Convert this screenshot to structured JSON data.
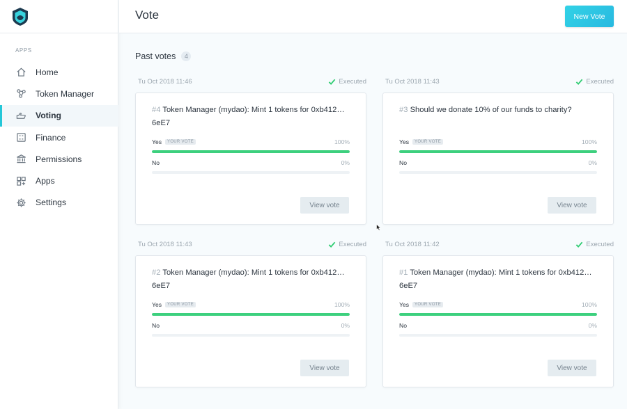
{
  "sidebar": {
    "apps_title": "APPS",
    "items": [
      {
        "label": "Home",
        "icon": "home-icon",
        "active": false
      },
      {
        "label": "Token Manager",
        "icon": "token-manager-icon",
        "active": false
      },
      {
        "label": "Voting",
        "icon": "voting-icon",
        "active": true
      },
      {
        "label": "Finance",
        "icon": "finance-icon",
        "active": false
      },
      {
        "label": "Permissions",
        "icon": "permissions-icon",
        "active": false
      },
      {
        "label": "Apps",
        "icon": "apps-icon",
        "active": false
      },
      {
        "label": "Settings",
        "icon": "settings-icon",
        "active": false
      }
    ]
  },
  "header": {
    "title": "Vote",
    "new_vote_label": "New Vote"
  },
  "main": {
    "section_title": "Past votes",
    "count": "4",
    "votes": [
      {
        "date": "Tu Oct 2018 11:46",
        "status": "Executed",
        "number": "#4",
        "question": "Token Manager (mydao): Mint 1 tokens for 0xb412… 6eE7",
        "yes_label": "Yes",
        "your_vote": "YOUR VOTE",
        "yes_pct": "100%",
        "yes_value": 100,
        "no_label": "No",
        "no_pct": "0%",
        "no_value": 0,
        "button": "View vote"
      },
      {
        "date": "Tu Oct 2018 11:43",
        "status": "Executed",
        "number": "#3",
        "question": "Should we donate 10% of our funds to charity?",
        "yes_label": "Yes",
        "your_vote": "YOUR VOTE",
        "yes_pct": "100%",
        "yes_value": 100,
        "no_label": "No",
        "no_pct": "0%",
        "no_value": 0,
        "button": "View vote"
      },
      {
        "date": "Tu Oct 2018 11:43",
        "status": "Executed",
        "number": "#2",
        "question": "Token Manager (mydao): Mint 1 tokens for 0xb412… 6eE7",
        "yes_label": "Yes",
        "your_vote": "YOUR VOTE",
        "yes_pct": "100%",
        "yes_value": 100,
        "no_label": "No",
        "no_pct": "0%",
        "no_value": 0,
        "button": "View vote"
      },
      {
        "date": "Tu Oct 2018 11:42",
        "status": "Executed",
        "number": "#1",
        "question": "Token Manager (mydao): Mint 1 tokens for 0xb412… 6eE7",
        "yes_label": "Yes",
        "your_vote": "YOUR VOTE",
        "yes_pct": "100%",
        "yes_value": 100,
        "no_label": "No",
        "no_pct": "0%",
        "no_value": 0,
        "button": "View vote"
      }
    ]
  },
  "colors": {
    "accent": "#24c7d8",
    "yes_bar": "#3dd07e",
    "executed": "#2ecc71"
  }
}
